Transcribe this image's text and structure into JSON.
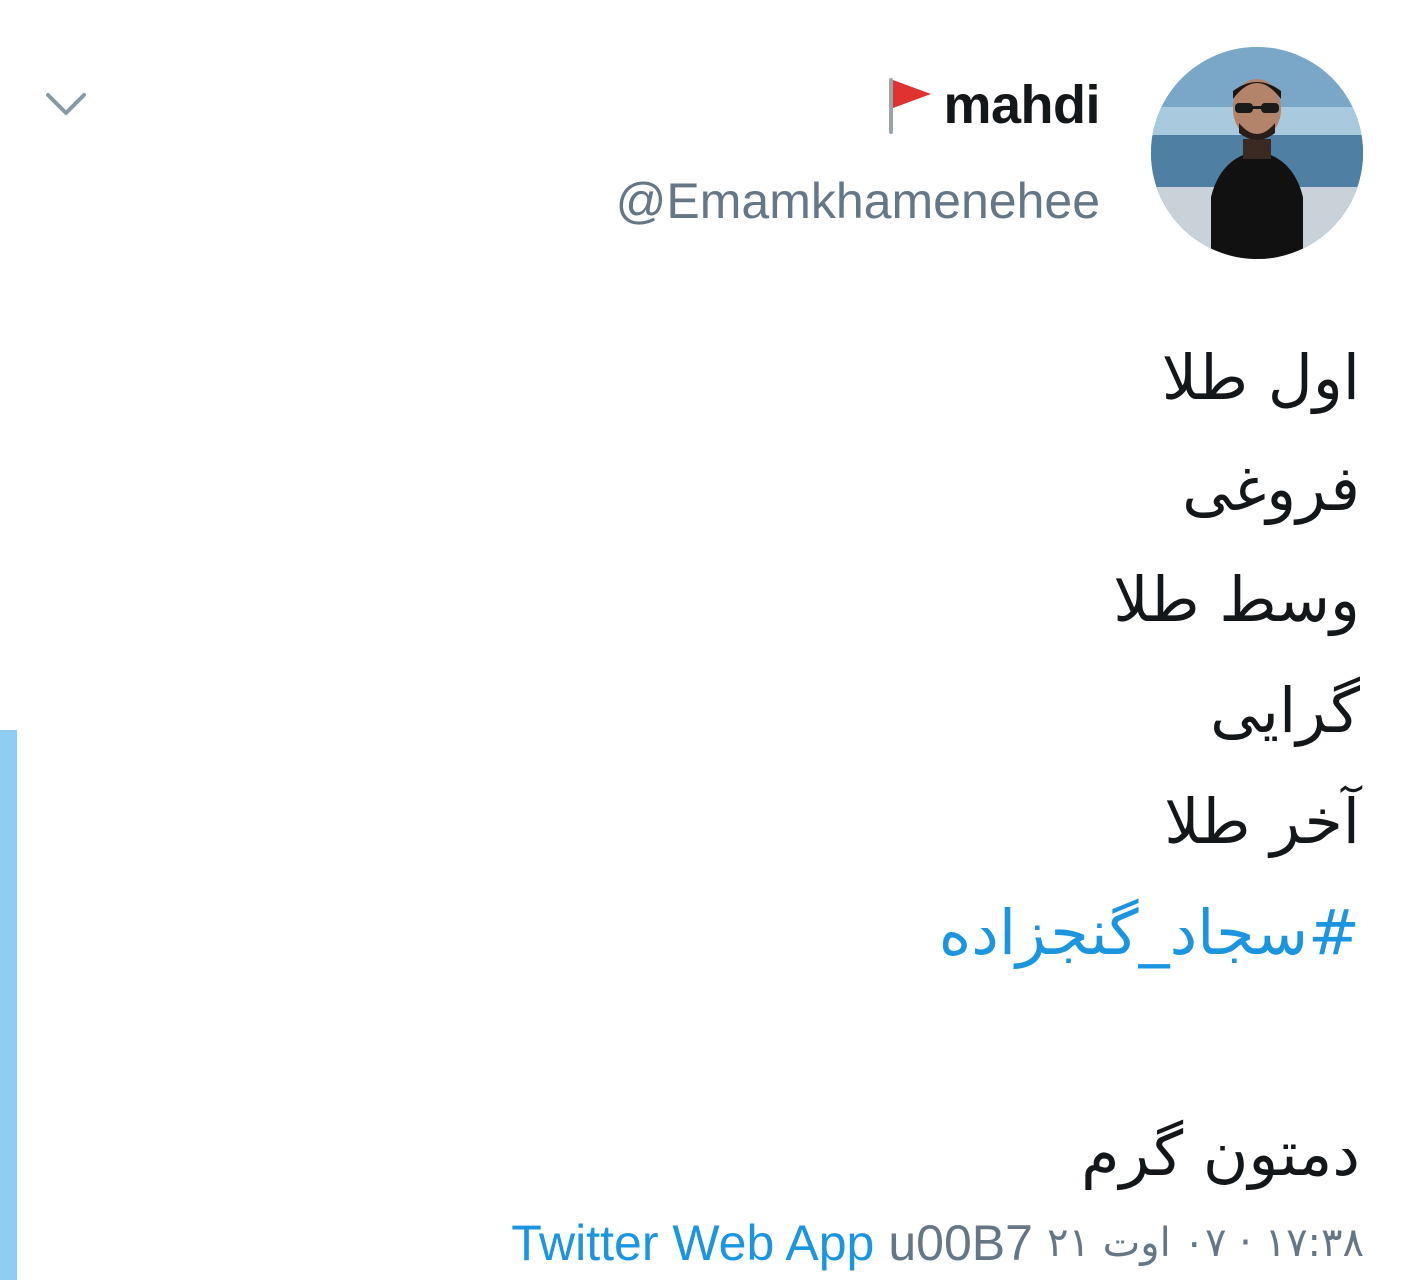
{
  "header": {
    "name": "mahdi",
    "handle": "@Emamkhamenehee",
    "flag_icon": "red-triangular-flag",
    "menu_icon": "chevron-down-icon"
  },
  "tweet": {
    "lines": [
      "اول طلا",
      "فروغی",
      "وسط طلا",
      "گرایی",
      "آخر طلا"
    ],
    "hashtag": "#سجاد_گنجزاده",
    "closing": "دمتون گرم"
  },
  "meta": {
    "time": "۱۷:۳۸ · ۰۷ اوت ۲۱",
    "separator": "u00B7",
    "source": "Twitter Web App"
  },
  "colors": {
    "link": "#1b95e0",
    "secondary_text": "#657786",
    "primary_text": "#14171a",
    "thread_bar": "#8ecdf4"
  }
}
